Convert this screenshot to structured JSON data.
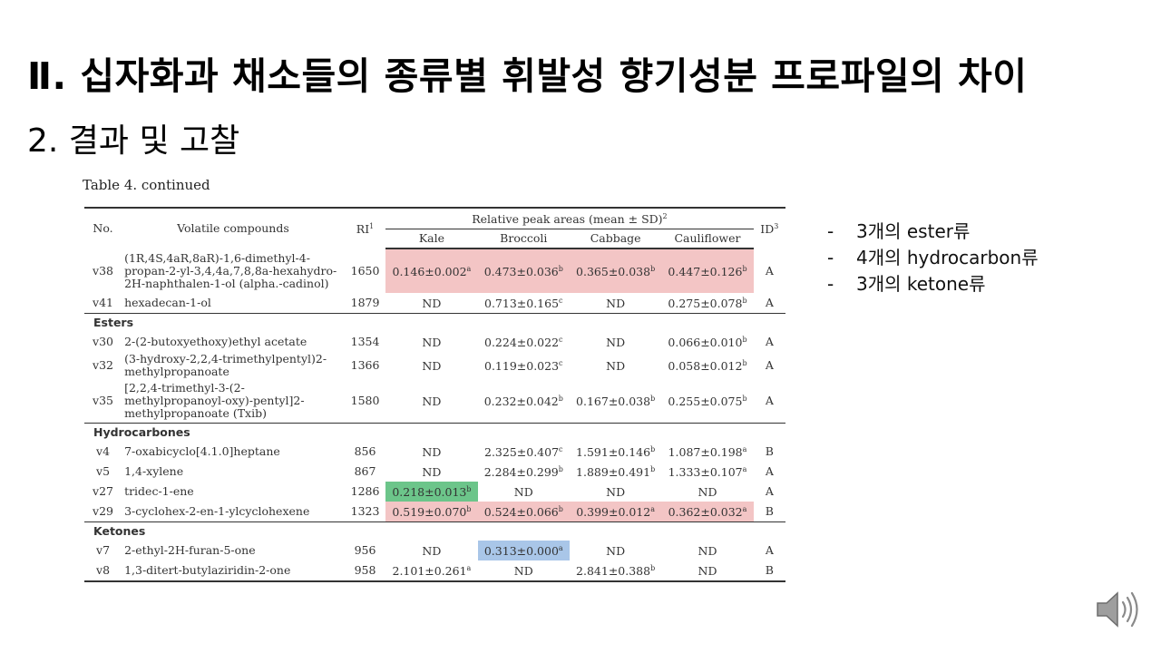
{
  "slide": {
    "title": "Ⅱ. 십자화과 채소들의 종류별 휘발성 향기성분 프로파일의 차이",
    "subtitle": "2. 결과 및 고찰"
  },
  "table": {
    "caption": "Table 4. continued",
    "header": {
      "no": "No.",
      "compound": "Volatile compounds",
      "ri": "RI",
      "ri_sup": "1",
      "group": "Relative peak areas (mean ± SD)",
      "group_sup": "2",
      "kale": "Kale",
      "broccoli": "Broccoli",
      "cabbage": "Cabbage",
      "cauliflower": "Cauliflower",
      "id": "ID",
      "id_sup": "3"
    },
    "rows": [
      {
        "no": "v38",
        "compound": "(1R,4S,4aR,8aR)-1,6-dimethyl-4-propan-2-yl-3,4,4a,7,8,8a-hexahydro-2H-naphthalen-1-ol (alpha.-cadinol)",
        "ri": "1650",
        "kale": "0.146±0.002",
        "kale_sup": "a",
        "broccoli": "0.473±0.036",
        "broccoli_sup": "b",
        "cabbage": "0.365±0.038",
        "cabbage_sup": "b",
        "cauliflower": "0.447±0.126",
        "cauliflower_sup": "b",
        "id": "A"
      },
      {
        "no": "v41",
        "compound": "hexadecan-1-ol",
        "ri": "1879",
        "kale": "ND",
        "kale_sup": "",
        "broccoli": "0.713±0.165",
        "broccoli_sup": "c",
        "cabbage": "ND",
        "cabbage_sup": "",
        "cauliflower": "0.275±0.078",
        "cauliflower_sup": "b",
        "id": "A"
      },
      {
        "section": "Esters"
      },
      {
        "no": "v30",
        "compound": "2-(2-butoxyethoxy)ethyl acetate",
        "ri": "1354",
        "kale": "ND",
        "kale_sup": "",
        "broccoli": "0.224±0.022",
        "broccoli_sup": "c",
        "cabbage": "ND",
        "cabbage_sup": "",
        "cauliflower": "0.066±0.010",
        "cauliflower_sup": "b",
        "id": "A"
      },
      {
        "no": "v32",
        "compound": "(3-hydroxy-2,2,4-trimethylpentyl)2-methylpropanoate",
        "ri": "1366",
        "kale": "ND",
        "kale_sup": "",
        "broccoli": "0.119±0.023",
        "broccoli_sup": "c",
        "cabbage": "ND",
        "cabbage_sup": "",
        "cauliflower": "0.058±0.012",
        "cauliflower_sup": "b",
        "id": "A"
      },
      {
        "no": "v35",
        "compound": "[2,2,4-trimethyl-3-(2-methylpropanoyl-oxy)-pentyl]2-methylpropanoate (Txib)",
        "ri": "1580",
        "kale": "ND",
        "kale_sup": "",
        "broccoli": "0.232±0.042",
        "broccoli_sup": "b",
        "cabbage": "0.167±0.038",
        "cabbage_sup": "b",
        "cauliflower": "0.255±0.075",
        "cauliflower_sup": "b",
        "id": "A"
      },
      {
        "section": "Hydrocarbones"
      },
      {
        "no": "v4",
        "compound": "7-oxabicyclo[4.1.0]heptane",
        "ri": "856",
        "kale": "ND",
        "kale_sup": "",
        "broccoli": "2.325±0.407",
        "broccoli_sup": "c",
        "cabbage": "1.591±0.146",
        "cabbage_sup": "b",
        "cauliflower": "1.087±0.198",
        "cauliflower_sup": "a",
        "id": "B"
      },
      {
        "no": "v5",
        "compound": "1,4-xylene",
        "ri": "867",
        "kale": "ND",
        "kale_sup": "",
        "broccoli": "2.284±0.299",
        "broccoli_sup": "b",
        "cabbage": "1.889±0.491",
        "cabbage_sup": "b",
        "cauliflower": "1.333±0.107",
        "cauliflower_sup": "a",
        "id": "A"
      },
      {
        "no": "v27",
        "compound": "tridec-1-ene",
        "ri": "1286",
        "kale": "0.218±0.013",
        "kale_sup": "b",
        "broccoli": "ND",
        "broccoli_sup": "",
        "cabbage": "ND",
        "cabbage_sup": "",
        "cauliflower": "ND",
        "cauliflower_sup": "",
        "id": "A"
      },
      {
        "no": "v29",
        "compound": "3-cyclohex-2-en-1-ylcyclohexene",
        "ri": "1323",
        "kale": "0.519±0.070",
        "kale_sup": "b",
        "broccoli": "0.524±0.066",
        "broccoli_sup": "b",
        "cabbage": "0.399±0.012",
        "cabbage_sup": "a",
        "cauliflower": "0.362±0.032",
        "cauliflower_sup": "a",
        "id": "B"
      },
      {
        "section": "Ketones"
      },
      {
        "no": "v7",
        "compound": "2-ethyl-2H-furan-5-one",
        "ri": "956",
        "kale": "ND",
        "kale_sup": "",
        "broccoli": "0.313±0.000",
        "broccoli_sup": "a",
        "cabbage": "ND",
        "cabbage_sup": "",
        "cauliflower": "ND",
        "cauliflower_sup": "",
        "id": "A"
      },
      {
        "no": "v8",
        "compound": "1,3-ditert-butylaziridin-2-one",
        "ri": "958",
        "kale": "2.101±0.261",
        "kale_sup": "a",
        "broccoli": "ND",
        "broccoli_sup": "",
        "cabbage": "2.841±0.388",
        "cabbage_sup": "b",
        "cauliflower": "ND",
        "cauliflower_sup": "",
        "id": "B"
      }
    ]
  },
  "highlights": {
    "red": "#f3c5c5",
    "green": "#6cc58a",
    "blue": "#a9c6e8"
  },
  "bullets": {
    "dash": "-",
    "items": [
      "3개의 ester류",
      "4개의 hydrocarbon류",
      "3개의 ketone류"
    ]
  },
  "speaker_icon": "speaker-volume-icon"
}
